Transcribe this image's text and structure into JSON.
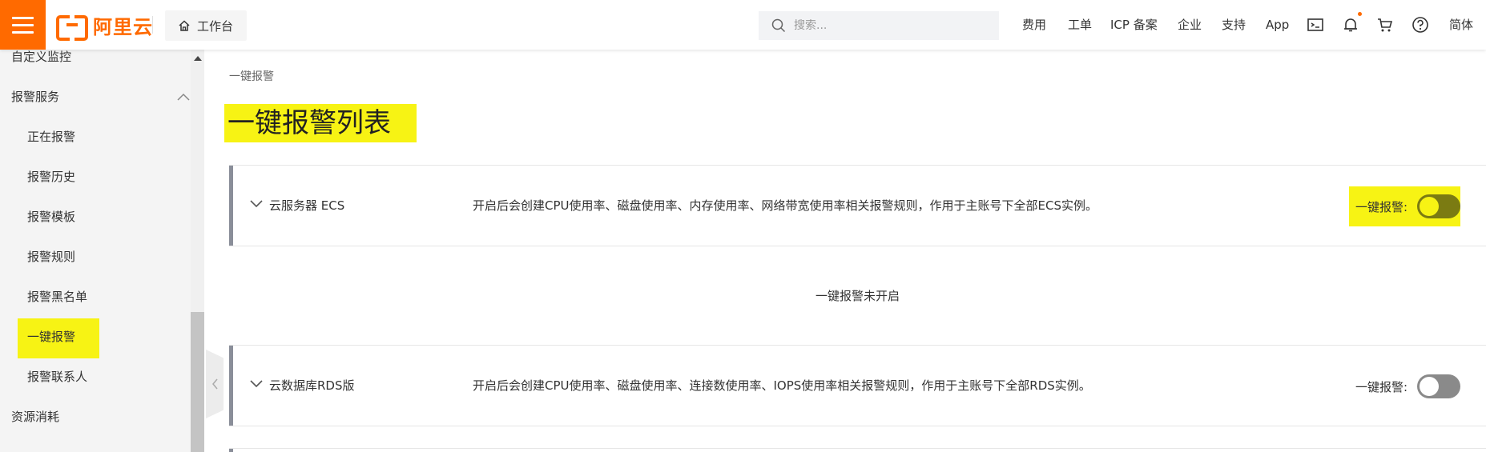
{
  "header": {
    "logo_text": "阿里云",
    "workbench_label": "工作台",
    "search_placeholder": "搜索...",
    "nav": [
      "费用",
      "工单",
      "ICP 备案",
      "企业",
      "支持",
      "App"
    ],
    "lang_label": "简体",
    "accent_color": "#ff6a00",
    "icons": [
      "menu-icon",
      "home-icon",
      "search-icon",
      "terminal-icon",
      "bell-icon",
      "cart-icon",
      "help-icon"
    ]
  },
  "sidebar": {
    "items": [
      {
        "label": "自定义监控",
        "level": "top"
      },
      {
        "label": "报警服务",
        "level": "top",
        "expanded": true
      },
      {
        "label": "正在报警",
        "level": "sub"
      },
      {
        "label": "报警历史",
        "level": "sub"
      },
      {
        "label": "报警模板",
        "level": "sub"
      },
      {
        "label": "报警规则",
        "level": "sub"
      },
      {
        "label": "报警黑名单",
        "level": "sub"
      },
      {
        "label": "一键报警",
        "level": "sub",
        "active": true
      },
      {
        "label": "报警联系人",
        "level": "sub"
      },
      {
        "label": "资源消耗",
        "level": "top"
      }
    ]
  },
  "main": {
    "breadcrumb": "一键报警",
    "title": "一键报警列表",
    "panels": [
      {
        "name": "云服务器 ECS",
        "description": "开启后会创建CPU使用率、磁盘使用率、内存使用率、网络带宽使用率相关报警规则，作用于主账号下全部ECS实例。",
        "toggle_label": "一键报警:",
        "enabled": false
      },
      {
        "name": "云数据库RDS版",
        "description": "开启后会创建CPU使用率、磁盘使用率、连接数使用率、IOPS使用率相关报警规则，作用于主账号下全部RDS实例。",
        "toggle_label": "一键报警:",
        "enabled": false
      }
    ],
    "status_text": "一键报警未开启"
  },
  "colors": {
    "highlight": "#f7f314",
    "toggle_off": "#8a8a8a",
    "toggle_off_highlighted": "#7b7b12",
    "panel_bar": "#8a8e99"
  }
}
